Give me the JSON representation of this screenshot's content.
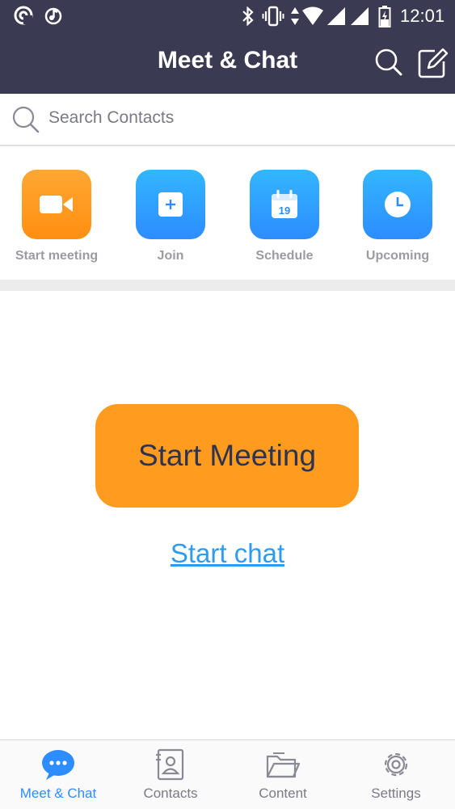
{
  "status_bar": {
    "time": "12:01",
    "icons": [
      "sync-icon",
      "music-icon",
      "bluetooth-icon",
      "vibrate-icon",
      "data-arrows-icon",
      "wifi-icon",
      "signal-icon",
      "signal-icon",
      "battery-icon"
    ]
  },
  "header": {
    "title": "Meet & Chat",
    "actions": [
      "search-icon",
      "compose-icon"
    ]
  },
  "search": {
    "placeholder": "Search Contacts",
    "icon": "search-icon"
  },
  "quick_actions": [
    {
      "label": "Start meeting",
      "icon": "video-camera-icon",
      "color": "#ff8f11"
    },
    {
      "label": "Join",
      "icon": "plus-icon",
      "color": "#2d8cff"
    },
    {
      "label": "Schedule",
      "icon": "calendar-icon",
      "calendar_day": "19",
      "color": "#2d8cff"
    },
    {
      "label": "Upcoming",
      "icon": "clock-icon",
      "color": "#2d8cff"
    }
  ],
  "main": {
    "start_meeting_label": "Start Meeting",
    "start_chat_label": "Start chat"
  },
  "tabs": [
    {
      "label": "Meet & Chat",
      "icon": "chat-bubble-icon",
      "active": true
    },
    {
      "label": "Contacts",
      "icon": "contacts-icon",
      "active": false
    },
    {
      "label": "Content",
      "icon": "folder-icon",
      "active": false
    },
    {
      "label": "Settings",
      "icon": "gear-icon",
      "active": false
    }
  ],
  "colors": {
    "header_bg": "#3a3a52",
    "accent_orange": "#ff9c1f",
    "accent_blue": "#2d8cff",
    "link_blue": "#2e9bf0"
  }
}
